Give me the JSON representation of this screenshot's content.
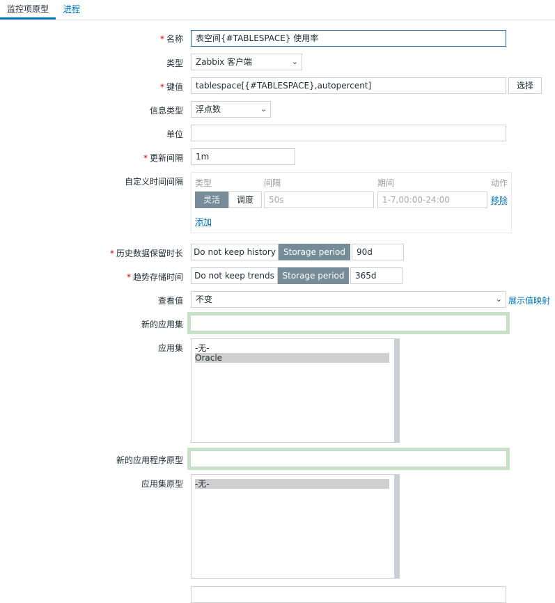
{
  "tabs": [
    {
      "label": "监控项原型"
    },
    {
      "label": "进程"
    }
  ],
  "form": {
    "name": {
      "label": "名称",
      "value": "表空间{#TABLESPACE} 使用率"
    },
    "type": {
      "label": "类型",
      "value": "Zabbix 客户端"
    },
    "key": {
      "label": "键值",
      "value": "tablespace[{#TABLESPACE},autopercent]",
      "select_button": "选择"
    },
    "value_type": {
      "label": "信息类型",
      "value": "浮点数"
    },
    "units": {
      "label": "单位",
      "value": ""
    },
    "update_interval": {
      "label": "更新间隔",
      "value": "1m"
    },
    "custom_intervals": {
      "label": "自定义时间间隔",
      "headers": {
        "type": "类型",
        "interval": "间隔",
        "period": "期间",
        "action": "动作"
      },
      "row": {
        "type_options": [
          "灵活",
          "调度"
        ],
        "selected_type": "灵活",
        "interval_placeholder": "50s",
        "period_placeholder": "1-7,00:00-24:00",
        "remove": "移除"
      },
      "add": "添加"
    },
    "history": {
      "label": "历史数据保留时长",
      "options": [
        "Do not keep history",
        "Storage period"
      ],
      "selected": "Storage period",
      "value": "90d"
    },
    "trends": {
      "label": "趋势存储时间",
      "options": [
        "Do not keep trends",
        "Storage period"
      ],
      "selected": "Storage period",
      "value": "365d"
    },
    "valuemap": {
      "label": "查看值",
      "value": "不变",
      "link": "展示值映射"
    },
    "new_application": {
      "label": "新的应用集",
      "value": ""
    },
    "applications": {
      "label": "应用集",
      "items": [
        "-无-",
        "Oracle"
      ],
      "selected": "Oracle"
    },
    "new_app_prototype": {
      "label": "新的应用程序原型",
      "value": ""
    },
    "app_prototypes": {
      "label": "应用集原型",
      "items": [
        "-无-"
      ],
      "selected": "-无-"
    }
  },
  "colors": {
    "accent": "#0275b8",
    "required": "#d40000",
    "segment_on": "#768d99",
    "focus_halo": "#c8e3c8"
  }
}
